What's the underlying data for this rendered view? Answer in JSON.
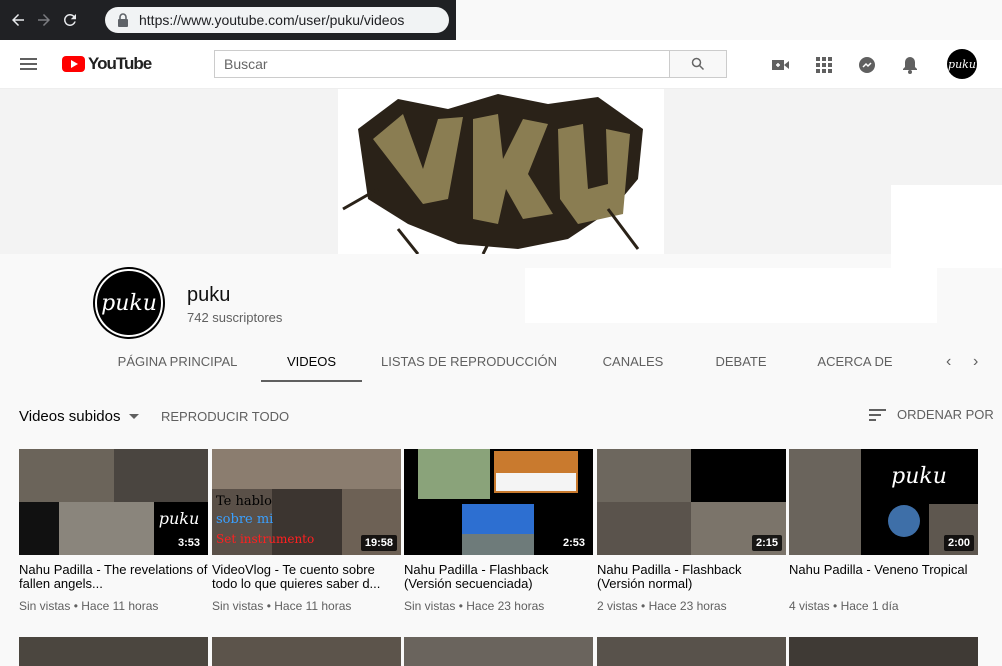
{
  "browser": {
    "url": "https://www.youtube.com/user/puku/videos"
  },
  "masthead": {
    "logo_text": "YouTube",
    "search_placeholder": "Buscar",
    "icons": [
      "menu-icon",
      "search-icon",
      "upload-video-icon",
      "apps-grid-icon",
      "messages-icon",
      "notifications-bell-icon",
      "account-avatar"
    ]
  },
  "channel": {
    "name": "puku",
    "subscribers": "742 suscriptores",
    "avatar_text": "puku"
  },
  "tabs": [
    {
      "label": "PÁGINA PRINCIPAL"
    },
    {
      "label": "VIDEOS"
    },
    {
      "label": "LISTAS DE REPRODUCCIÓN"
    },
    {
      "label": "CANALES"
    },
    {
      "label": "DEBATE"
    },
    {
      "label": "ACERCA DE"
    }
  ],
  "active_tab": "VIDEOS",
  "section": {
    "title": "Videos subidos",
    "play_all": "REPRODUCIR TODO",
    "sort_by": "ORDENAR POR"
  },
  "videos": [
    {
      "title": "Nahu Padilla - The revelations of fallen angels...",
      "views": "Sin vistas",
      "age": "Hace 11 horas",
      "duration": "3:53"
    },
    {
      "title": "VideoVlog - Te cuento sobre todo lo que quieres saber d...",
      "views": "Sin vistas",
      "age": "Hace 11 horas",
      "duration": "19:58",
      "overlay_lines": [
        "Te hablo",
        "sobre mi",
        "Set instrumento"
      ]
    },
    {
      "title": "Nahu Padilla - Flashback (Versión secuenciada)",
      "views": "Sin vistas",
      "age": "Hace 23 horas",
      "duration": "2:53"
    },
    {
      "title": "Nahu Padilla - Flashback (Versión normal)",
      "views": "2 vistas",
      "age": "Hace 23 horas",
      "duration": "2:15"
    },
    {
      "title": "Nahu Padilla - Veneno Tropical",
      "views": "4 vistas",
      "age": "Hace 1 día",
      "duration": "2:00"
    }
  ],
  "colors": {
    "brand_red": "#ff0000",
    "page_bg": "#f9f9f9",
    "secondary_text": "#606060"
  }
}
